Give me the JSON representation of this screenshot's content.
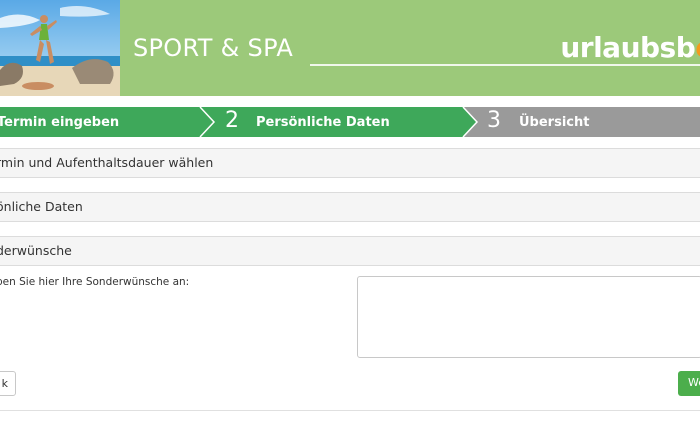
{
  "header": {
    "title": "SPORT & SPA",
    "logo_text": "urlaubsb",
    "logo_tail": "o"
  },
  "steps": [
    {
      "number": "",
      "label": "Termin eingeben"
    },
    {
      "number": "2",
      "label": "Persönliche Daten"
    },
    {
      "number": "3",
      "label": "Übersicht"
    }
  ],
  "sections": [
    {
      "label": "rmin und Aufenthaltsdauer wählen"
    },
    {
      "label": "önliche Daten"
    },
    {
      "label": "derwünsche"
    }
  ],
  "special_requests": {
    "prompt": "ben Sie hier Ihre Sonderwünsche an:",
    "value": ""
  },
  "buttons": {
    "back_label": "k",
    "next_label": "We"
  },
  "colors": {
    "header_green": "#9cc97a",
    "step_active_green": "#3ea85a",
    "step_inactive_gray": "#999999",
    "button_green": "#4cae4c",
    "logo_orange": "#f39a1e"
  }
}
